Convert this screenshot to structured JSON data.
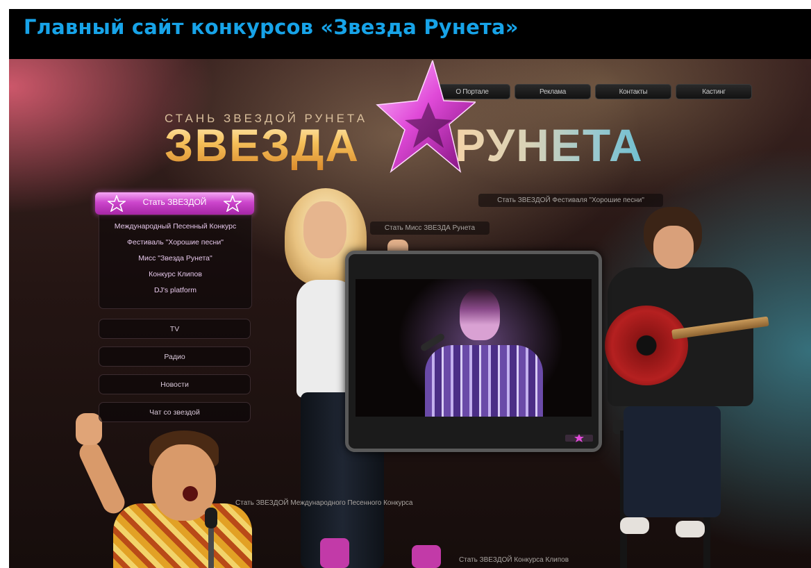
{
  "page_heading": "Главный сайт конкурсов «Звезда Рунета»",
  "top_nav": [
    {
      "label": "О Портале"
    },
    {
      "label": "Реклама"
    },
    {
      "label": "Контакты"
    },
    {
      "label": "Кастинг"
    }
  ],
  "logo": {
    "tagline": "СТАНЬ ЗВЕЗДОЙ РУНЕТА",
    "word_left": "ЗВЕЗДА",
    "word_right": "РУНЕТА"
  },
  "side_menu": {
    "header": "Стать ЗВЕЗДОЙ",
    "links": [
      {
        "label": "Международный Песенный Конкурс"
      },
      {
        "label": "Фестиваль \"Хорошие песни\""
      },
      {
        "label": "Мисс \"Звезда Рунета\""
      },
      {
        "label": "Конкурс Клипов"
      },
      {
        "label": "DJ's platform"
      }
    ],
    "buttons": [
      {
        "label": "TV"
      },
      {
        "label": "Радио"
      },
      {
        "label": "Новости"
      },
      {
        "label": "Чат со звездой"
      }
    ]
  },
  "scene_labels": {
    "festival": "Стать ЗВЕЗДОЙ Фестиваля \"Хорошие песни\"",
    "miss": "Стать Мисс ЗВЕЗДА Рунета",
    "song_contest": "Стать ЗВЕЗДОЙ Международного Песенного Конкурса",
    "clips": "Стать ЗВЕЗДОЙ Конкурса Клипов"
  },
  "colors": {
    "heading": "#17a3e8",
    "accent_pink": "#cc46cc"
  }
}
